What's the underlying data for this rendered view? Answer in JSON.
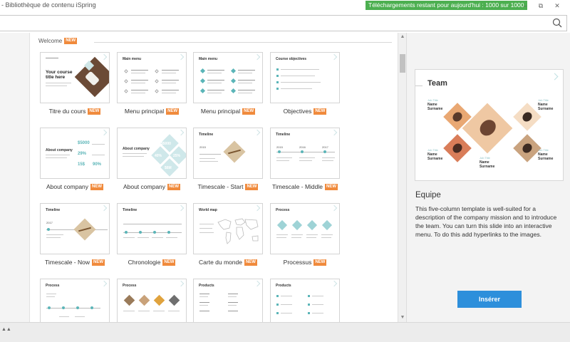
{
  "window": {
    "title": "- Bibliothèque de contenu iSpring",
    "quota": "Téléchargements restant pour aujourd'hui : 1000 sur 1000",
    "minimize_icon": "minimize-icon",
    "restore_icon": "restore-icon",
    "close_icon": "close-icon"
  },
  "search": {
    "value": "",
    "placeholder": "",
    "icon": "search-icon"
  },
  "section": {
    "title": "Welcome",
    "badge": "NEW"
  },
  "thumbs": {
    "title_slide": {
      "title": "Your course title here"
    },
    "main_menu": "Main menu",
    "objectives": "Course objectives",
    "about": "About company",
    "about_stats": [
      "$5000",
      "29%",
      "15$",
      "90%"
    ],
    "about_diamonds": [
      "$5000",
      "40%",
      "25%",
      "$6M"
    ],
    "timeline": "Timeline",
    "timeline_years": [
      "2015",
      "2016",
      "2017"
    ],
    "timeline_now_year": "2017",
    "worldmap": "World map",
    "process": "Process",
    "products": "Products"
  },
  "tiles": [
    {
      "label": "Titre du cours",
      "badge": "NEW"
    },
    {
      "label": "Menu principal",
      "badge": "NEW"
    },
    {
      "label": "Menu principal",
      "badge": "NEW"
    },
    {
      "label": "Objectives",
      "badge": "NEW"
    },
    {
      "label": "About company",
      "badge": "NEW"
    },
    {
      "label": "About company",
      "badge": "NEW"
    },
    {
      "label": "Timescale - Start",
      "badge": "NEW"
    },
    {
      "label": "Timescale - Middle",
      "badge": "NEW"
    },
    {
      "label": "Timescale - Now",
      "badge": "NEW"
    },
    {
      "label": "Chronologie",
      "badge": "NEW"
    },
    {
      "label": "Carte du monde",
      "badge": "NEW"
    },
    {
      "label": "Processus",
      "badge": "NEW"
    }
  ],
  "preview": {
    "slide_title": "Team",
    "member_tag": "Job Title",
    "member_name": "Name",
    "member_surname": "Surname",
    "name": "Equipe",
    "description": "This five-column template is well-suited for a description of the company mission and to introduce the team. You can turn this slide into an interactive menu. To do this add hyperlinks to the images.",
    "insert_label": "Insérer"
  },
  "colors": {
    "accent": "#f08a3c",
    "teal": "#5bb5b8",
    "button": "#2d8fdb",
    "quota_bg": "#4caf50"
  }
}
